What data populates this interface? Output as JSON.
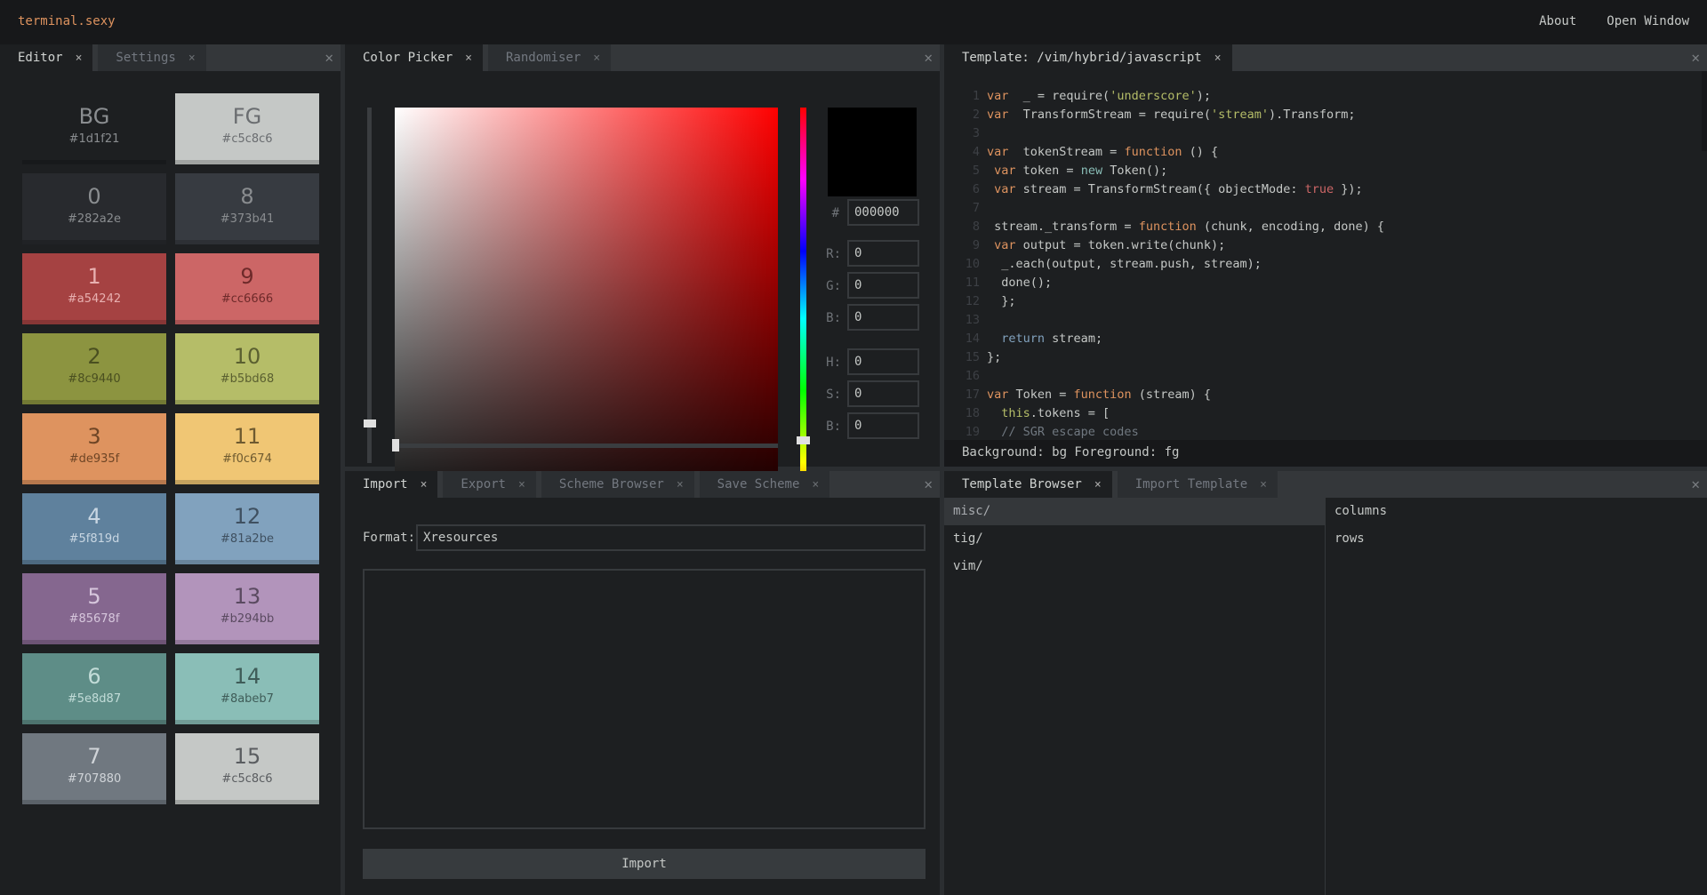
{
  "header": {
    "brand": "terminal.sexy",
    "nav": [
      "About",
      "Open Window"
    ]
  },
  "editor_panel": {
    "tabs": [
      {
        "label": "Editor",
        "active": true
      },
      {
        "label": "Settings",
        "active": false
      }
    ],
    "swatches": [
      {
        "label": "BG",
        "hex": "#1d1f21",
        "text": "#8a8d90"
      },
      {
        "label": "FG",
        "hex": "#c5c8c6",
        "text": "#6a6d70"
      },
      {
        "label": "0",
        "hex": "#282a2e",
        "text": "#8a8d90"
      },
      {
        "label": "8",
        "hex": "#373b41",
        "text": "#8a8d90"
      },
      {
        "label": "1",
        "hex": "#a54242",
        "text": "#e8b0b0"
      },
      {
        "label": "9",
        "hex": "#cc6666",
        "text": "#6e2a2a"
      },
      {
        "label": "2",
        "hex": "#8c9440",
        "text": "#4a4f20"
      },
      {
        "label": "10",
        "hex": "#b5bd68",
        "text": "#5a5f30"
      },
      {
        "label": "3",
        "hex": "#de935f",
        "text": "#6e4525"
      },
      {
        "label": "11",
        "hex": "#f0c674",
        "text": "#6e5a30"
      },
      {
        "label": "4",
        "hex": "#5f819d",
        "text": "#c8d6e2"
      },
      {
        "label": "12",
        "hex": "#81a2be",
        "text": "#3f5060"
      },
      {
        "label": "5",
        "hex": "#85678f",
        "text": "#d6c6dc"
      },
      {
        "label": "13",
        "hex": "#b294bb",
        "text": "#5a4a60"
      },
      {
        "label": "6",
        "hex": "#5e8d87",
        "text": "#c2dcd8"
      },
      {
        "label": "14",
        "hex": "#8abeb7",
        "text": "#3f5c58"
      },
      {
        "label": "7",
        "hex": "#707880",
        "text": "#d0d4d8"
      },
      {
        "label": "15",
        "hex": "#c5c8c6",
        "text": "#5a5d60"
      }
    ]
  },
  "color_picker_panel": {
    "tabs": [
      {
        "label": "Color Picker",
        "active": true
      },
      {
        "label": "Randomiser",
        "active": false
      }
    ],
    "hue_color": "#ff0000",
    "preview_color": "#000000",
    "hex_label": "#",
    "hex_value": "000000",
    "fields": [
      {
        "label": "R:",
        "value": "0"
      },
      {
        "label": "G:",
        "value": "0"
      },
      {
        "label": "B:",
        "value": "0"
      },
      {
        "label": "H:",
        "value": "0"
      },
      {
        "label": "S:",
        "value": "0"
      },
      {
        "label": "B:",
        "value": "0"
      }
    ]
  },
  "template_panel": {
    "tabs": [
      {
        "label": "Template: /vim/hybrid/javascript",
        "active": true
      }
    ],
    "code_lines": [
      [
        [
          "kw",
          "var"
        ],
        [
          "",
          "  _ = require("
        ],
        [
          "str",
          "'underscore'"
        ],
        [
          "",
          ");"
        ]
      ],
      [
        [
          "kw",
          "var"
        ],
        [
          "",
          "  TransformStream = require("
        ],
        [
          "str",
          "'stream'"
        ],
        [
          "",
          ").Transform;"
        ]
      ],
      [],
      [
        [
          "kw",
          "var"
        ],
        [
          "",
          "  tokenStream = "
        ],
        [
          "kw",
          "function"
        ],
        [
          "",
          " () {"
        ]
      ],
      [
        [
          "",
          " "
        ],
        [
          "kw",
          "var"
        ],
        [
          "",
          " token = "
        ],
        [
          "nw",
          "new"
        ],
        [
          "",
          " Token();"
        ]
      ],
      [
        [
          "",
          " "
        ],
        [
          "kw",
          "var"
        ],
        [
          "",
          " stream = TransformStream({ objectMode: "
        ],
        [
          "bool",
          "true"
        ],
        [
          "",
          " });"
        ]
      ],
      [],
      [
        [
          "",
          " stream._transform = "
        ],
        [
          "kw",
          "function"
        ],
        [
          "",
          " (chunk, encoding, done) {"
        ]
      ],
      [
        [
          "",
          " "
        ],
        [
          "kw",
          "var"
        ],
        [
          "",
          " output = token.write(chunk);"
        ]
      ],
      [
        [
          "",
          "  _.each(output, stream.push, stream);"
        ]
      ],
      [
        [
          "",
          "  done();"
        ]
      ],
      [
        [
          "",
          "  };"
        ]
      ],
      [],
      [
        [
          "",
          "  "
        ],
        [
          "ret",
          "return"
        ],
        [
          "",
          " stream;"
        ]
      ],
      [
        [
          "",
          "};"
        ]
      ],
      [],
      [
        [
          "kw",
          "var"
        ],
        [
          "",
          " Token = "
        ],
        [
          "kw",
          "function"
        ],
        [
          "",
          " (stream) {"
        ]
      ],
      [
        [
          "",
          "  "
        ],
        [
          "ths",
          "this"
        ],
        [
          "",
          ".tokens = ["
        ]
      ],
      [
        [
          "",
          "  "
        ],
        [
          "cmt",
          "// SGR escape codes"
        ]
      ]
    ],
    "status": "Background: bg Foreground: fg"
  },
  "import_panel": {
    "tabs": [
      {
        "label": "Import",
        "active": true
      },
      {
        "label": "Export",
        "active": false
      },
      {
        "label": "Scheme Browser",
        "active": false
      },
      {
        "label": "Save Scheme",
        "active": false
      }
    ],
    "format_label": "Format:",
    "format_value": "Xresources",
    "textarea_value": "",
    "button_label": "Import"
  },
  "template_browser_panel": {
    "tabs": [
      {
        "label": "Template Browser",
        "active": true
      },
      {
        "label": "Import Template",
        "active": false
      }
    ],
    "folders": [
      {
        "label": "misc/",
        "selected": true
      },
      {
        "label": "tig/",
        "selected": false
      },
      {
        "label": "vim/",
        "selected": false
      }
    ],
    "files": [
      "columns",
      "rows"
    ]
  }
}
